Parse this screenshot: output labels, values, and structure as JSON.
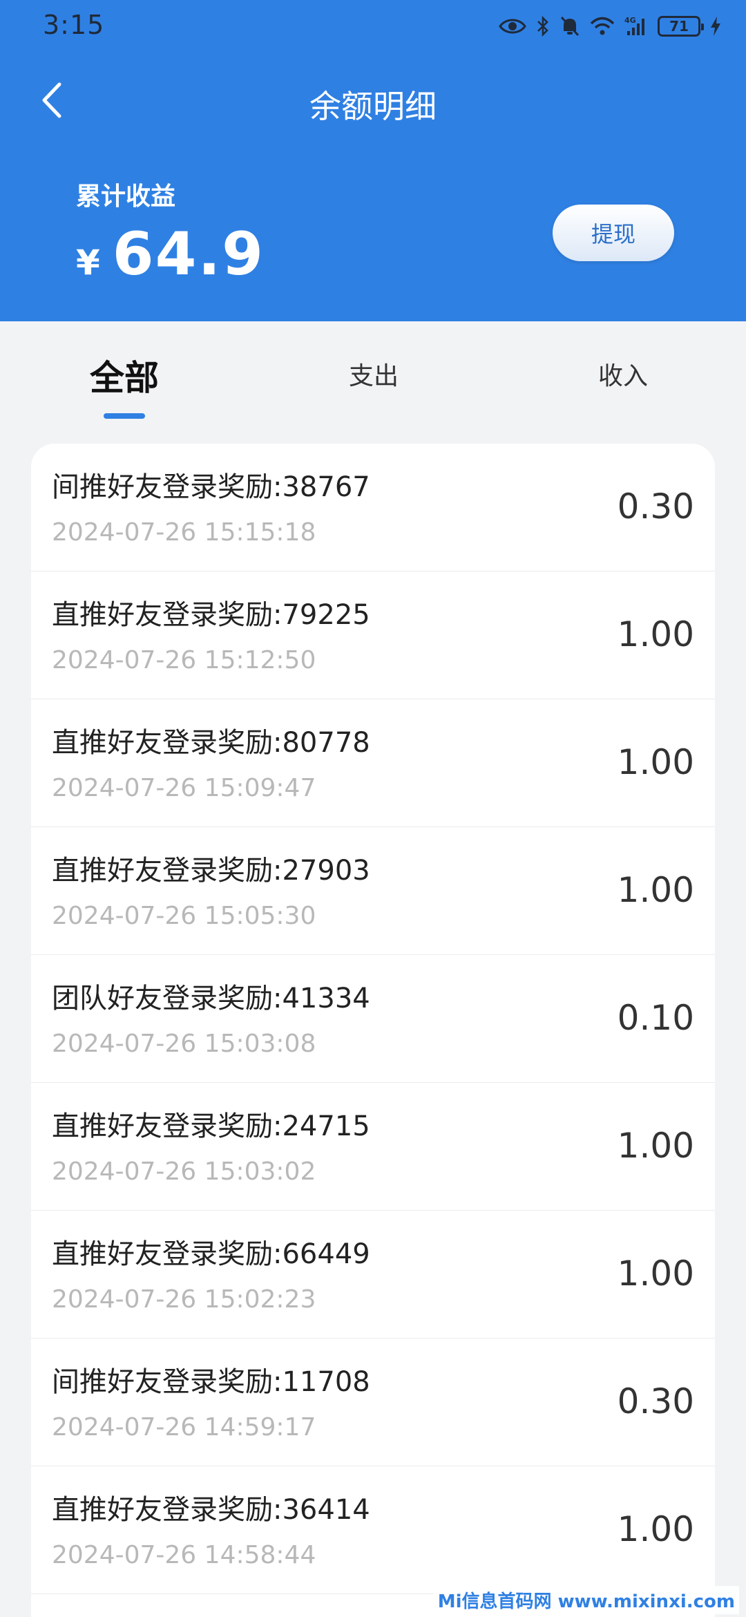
{
  "status_bar": {
    "time": "3:15",
    "battery": "71",
    "network": "4G",
    "icons": [
      "eye-icon",
      "bluetooth-icon",
      "bell-off-icon",
      "wifi-icon",
      "signal-icon",
      "battery-icon",
      "charging-icon"
    ]
  },
  "nav": {
    "title": "余额明细",
    "back_icon": "chevron-left-icon"
  },
  "summary": {
    "label": "累计收益",
    "currency": "¥",
    "amount": "64.9",
    "withdraw_label": "提现"
  },
  "tabs": [
    {
      "label": "全部",
      "active": true
    },
    {
      "label": "支出",
      "active": false
    },
    {
      "label": "收入",
      "active": false
    }
  ],
  "transactions": [
    {
      "title": "间推好友登录奖励:38767",
      "time": "2024-07-26 15:15:18",
      "amount": "0.30"
    },
    {
      "title": "直推好友登录奖励:79225",
      "time": "2024-07-26 15:12:50",
      "amount": "1.00"
    },
    {
      "title": "直推好友登录奖励:80778",
      "time": "2024-07-26 15:09:47",
      "amount": "1.00"
    },
    {
      "title": "直推好友登录奖励:27903",
      "time": "2024-07-26 15:05:30",
      "amount": "1.00"
    },
    {
      "title": "团队好友登录奖励:41334",
      "time": "2024-07-26 15:03:08",
      "amount": "0.10"
    },
    {
      "title": "直推好友登录奖励:24715",
      "time": "2024-07-26 15:03:02",
      "amount": "1.00"
    },
    {
      "title": "直推好友登录奖励:66449",
      "time": "2024-07-26 15:02:23",
      "amount": "1.00"
    },
    {
      "title": "间推好友登录奖励:11708",
      "time": "2024-07-26 14:59:17",
      "amount": "0.30"
    },
    {
      "title": "直推好友登录奖励:36414",
      "time": "2024-07-26 14:58:44",
      "amount": "1.00"
    }
  ],
  "watermark": "Mi信息首码网 www.mixinxi.com",
  "colors": {
    "header_blue": "#2f80e3",
    "background": "#f2f3f5",
    "time_gray": "#b8b8b8"
  }
}
